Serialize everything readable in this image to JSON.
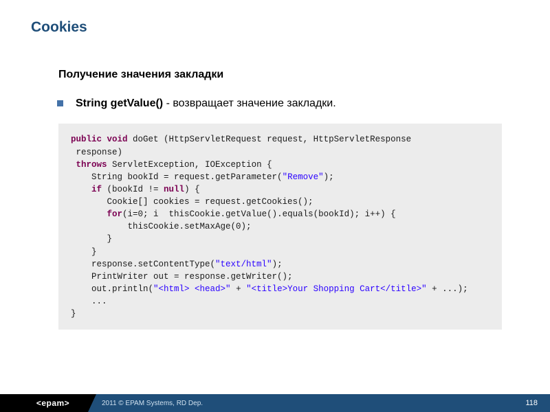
{
  "title": "Cookies",
  "subheading": "Получение значения закладки",
  "bullet": {
    "bold": "String getValue()",
    "rest": " - возвращает значение закладки."
  },
  "code": {
    "l1a": "public",
    "l1b": " ",
    "l1c": "void",
    "l1d": " doGet (HttpServletRequest request, HttpServletResponse",
    "l2": " response)",
    "l3a": " ",
    "l3b": "throws",
    "l3c": " ServletException, IOException {",
    "l4a": "    String bookId = request.getParameter(",
    "l4b": "\"Remove\"",
    "l4c": ");",
    "l5a": "    ",
    "l5b": "if",
    "l5c": " (bookId != ",
    "l5d": "null",
    "l5e": ") {",
    "l6": "       Cookie[] cookies = request.getCookies();",
    "l7a": "       ",
    "l7b": "for",
    "l7c": "(i=0; i  thisCookie.getValue().equals(bookId); i++) {",
    "l8": "           thisCookie.setMaxAge(0);",
    "l9": "       }",
    "l10": "    }",
    "l11a": "    response.setContentType(",
    "l11b": "\"text/html\"",
    "l11c": ");",
    "l12": "    PrintWriter out = response.getWriter();",
    "l13a": "    out.println(",
    "l13b": "\"<html> <head>\"",
    "l13c": " + ",
    "l13d": "\"<title>Your Shopping Cart</title>\"",
    "l13e": " + ...);",
    "l14": "    ...",
    "l15": "}"
  },
  "footer": {
    "logo": "<epam>",
    "copyright": "2011 © EPAM Systems, RD Dep.",
    "page": "118"
  }
}
